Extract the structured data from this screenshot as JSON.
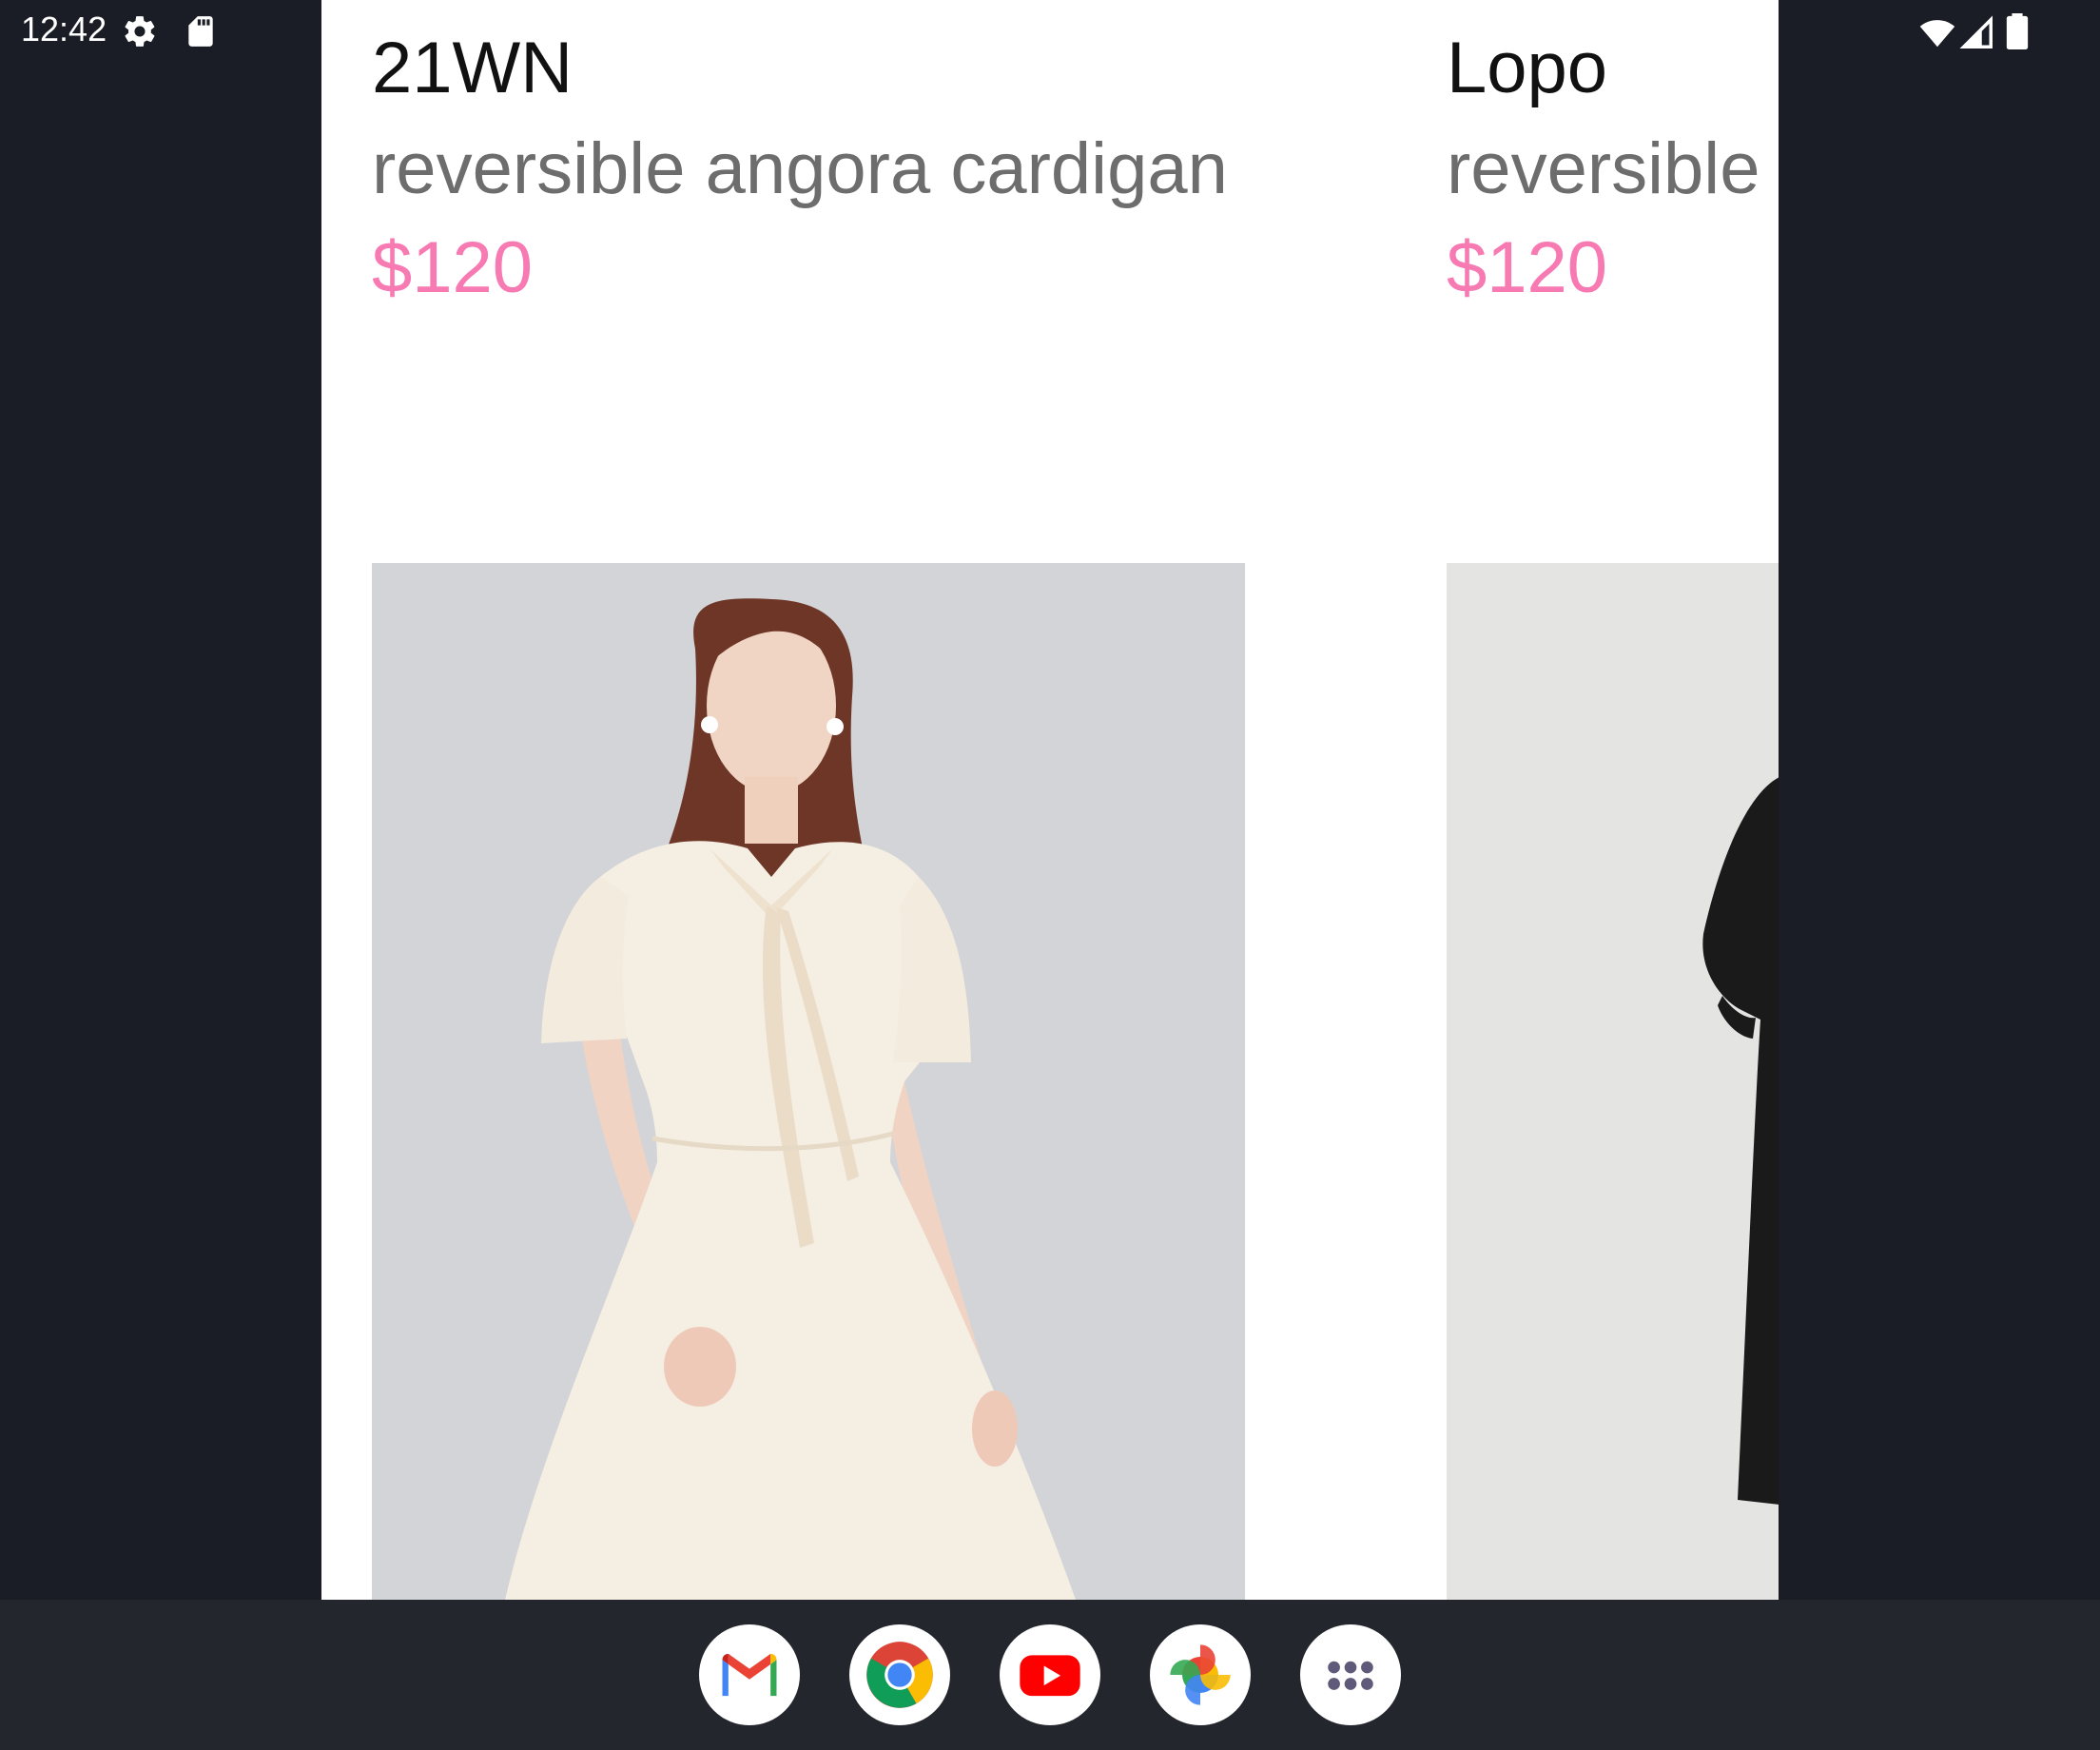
{
  "status_bar": {
    "time": "12:42",
    "left_icons": [
      "gear-icon",
      "sd-card-icon"
    ],
    "right_icons": [
      "wifi-icon",
      "cell-signal-icon",
      "battery-icon"
    ]
  },
  "products": [
    {
      "brand": "21WN",
      "name": "reversible angora cardigan",
      "price": "$120",
      "image": "model-in-cream-dress-photo"
    },
    {
      "brand": "Lopo",
      "name": "reversible",
      "price": "$120",
      "image": "model-in-black-outfit-photo"
    }
  ],
  "dock": {
    "apps": [
      "gmail",
      "chrome",
      "youtube",
      "google-photos",
      "app-launcher"
    ]
  },
  "colors": {
    "price": "#f77ab2",
    "background": "#1b1d26",
    "taskbar": "#24262e",
    "app_surface": "#ffffff"
  }
}
